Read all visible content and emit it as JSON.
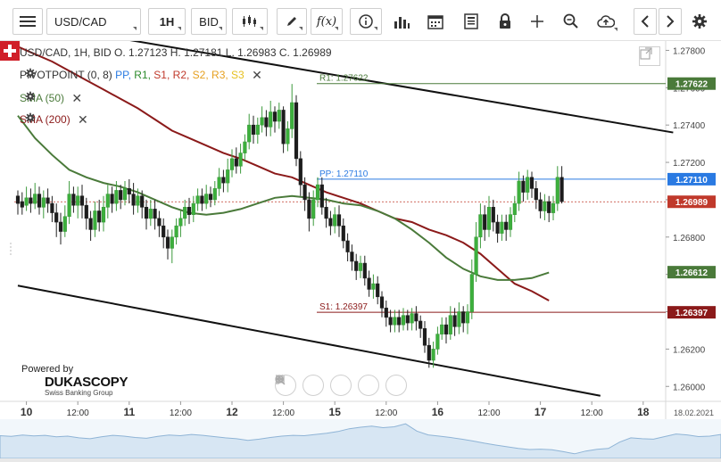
{
  "toolbar": {
    "symbol": "USD/CAD",
    "timeframe": "1H",
    "price_side": "BID",
    "function_label": "f(x)"
  },
  "legend": {
    "ohlc": "USD/CAD, 1H, BID   O. 1.27123 H. 1.27181 L. 1.26983 C. 1.26989",
    "pivot_title": "PIVOTPOINT (0, 8)",
    "pivot_items": [
      {
        "label": "PP,",
        "color": "#2a7ae2"
      },
      {
        "label": "R1,",
        "color": "#2e8b2e"
      },
      {
        "label": "S1,",
        "color": "#c0392b"
      },
      {
        "label": "R2,",
        "color": "#c0392b"
      },
      {
        "label": "S2,",
        "color": "#e6a020"
      },
      {
        "label": "R3,",
        "color": "#e6a020"
      },
      {
        "label": "S3",
        "color": "#e6c020"
      }
    ],
    "sma50": "SMA (50)",
    "sma200": "SMA (200)",
    "sma50_color": "#4a7a3a",
    "sma200_color": "#8b1a1a"
  },
  "branding": {
    "powered": "Powered by",
    "name": "DUKASCOPY",
    "sub": "Swiss Banking Group"
  },
  "chart_data": {
    "type": "candlestick",
    "ylim": [
      1.2592,
      1.2785
    ],
    "y_ticks": [
      "1.27800",
      "1.27600",
      "1.27400",
      "1.27200",
      "1.27000",
      "1.26800",
      "1.26600",
      "1.26400",
      "1.26200",
      "1.26000"
    ],
    "y_tick_values": [
      1.278,
      1.276,
      1.274,
      1.272,
      1.27,
      1.268,
      1.266,
      1.264,
      1.262,
      1.26
    ],
    "x_ticks": [
      {
        "label": "10",
        "bold": true,
        "i": 2
      },
      {
        "label": "12:00",
        "bold": false,
        "i": 14
      },
      {
        "label": "11",
        "bold": true,
        "i": 26
      },
      {
        "label": "12:00",
        "bold": false,
        "i": 38
      },
      {
        "label": "12",
        "bold": true,
        "i": 50
      },
      {
        "label": "12:00",
        "bold": false,
        "i": 62
      },
      {
        "label": "15",
        "bold": true,
        "i": 74
      },
      {
        "label": "12:00",
        "bold": false,
        "i": 86
      },
      {
        "label": "16",
        "bold": true,
        "i": 98
      },
      {
        "label": "12:00",
        "bold": false,
        "i": 110
      },
      {
        "label": "17",
        "bold": true,
        "i": 122
      },
      {
        "label": "12:00",
        "bold": false,
        "i": 134
      },
      {
        "label": "18",
        "bold": true,
        "i": 146
      }
    ],
    "date_right": "18.02.2021",
    "pivot_levels": [
      {
        "name": "R1",
        "label": "R1: 1.27622",
        "value": 1.27622,
        "badge": "1.27622",
        "color": "#4a7a3a"
      },
      {
        "name": "PP",
        "label": "PP: 1.27110",
        "value": 1.2711,
        "badge": "1.27110",
        "color": "#2a7ae2"
      },
      {
        "name": "S1",
        "label": "S1: 1.26397",
        "value": 1.26397,
        "badge": "1.26397",
        "color": "#8b1a1a"
      }
    ],
    "last_price": {
      "value": 1.26989,
      "badge": "1.26989",
      "color": "#c0392b"
    },
    "sma50_last": {
      "value": 1.26612,
      "badge": "1.26612",
      "color": "#4a7a3a"
    },
    "channel_lines": [
      {
        "i1": 12,
        "v1": 1.2791,
        "i2": 153,
        "v2": 1.2736
      },
      {
        "i1": 0,
        "v1": 1.2654,
        "i2": 136,
        "v2": 1.2595
      }
    ],
    "sma200": {
      "start_i": 0,
      "step": 4,
      "values": [
        1.2782,
        1.2778,
        1.2774,
        1.2769,
        1.2764,
        1.2759,
        1.2754,
        1.2749,
        1.2743,
        1.2737,
        1.2733,
        1.2729,
        1.2725,
        1.2722,
        1.2718,
        1.2714,
        1.2712,
        1.2708,
        1.2704,
        1.2701,
        1.2698,
        1.2694,
        1.269,
        1.2688,
        1.2684,
        1.2681,
        1.2677,
        1.2671,
        1.2663,
        1.2655,
        1.2651,
        1.2646
      ]
    },
    "sma50": {
      "start_i": 0,
      "step": 4,
      "values": [
        1.2745,
        1.2733,
        1.2724,
        1.2716,
        1.2712,
        1.2709,
        1.2707,
        1.2704,
        1.27,
        1.2696,
        1.2693,
        1.2692,
        1.2693,
        1.2695,
        1.2698,
        1.2701,
        1.2702,
        1.2701,
        1.27,
        1.2698,
        1.2697,
        1.2694,
        1.269,
        1.2684,
        1.2677,
        1.2669,
        1.2663,
        1.2659,
        1.2657,
        1.2657,
        1.2658,
        1.2661
      ]
    },
    "candles": [
      [
        1.2702,
        1.2698,
        1.2705,
        1.2692
      ],
      [
        1.2699,
        1.2696,
        1.2704,
        1.2692
      ],
      [
        1.2697,
        1.2701,
        1.2707,
        1.2694
      ],
      [
        1.2701,
        1.2698,
        1.2706,
        1.2693
      ],
      [
        1.2698,
        1.2703,
        1.2709,
        1.2695
      ],
      [
        1.2703,
        1.2696,
        1.2707,
        1.2692
      ],
      [
        1.2696,
        1.2701,
        1.2705,
        1.269
      ],
      [
        1.2701,
        1.2698,
        1.2706,
        1.2693
      ],
      [
        1.2698,
        1.2693,
        1.2702,
        1.2688
      ],
      [
        1.2693,
        1.2688,
        1.2698,
        1.268
      ],
      [
        1.2688,
        1.2683,
        1.2693,
        1.2676
      ],
      [
        1.2683,
        1.2691,
        1.2697,
        1.268
      ],
      [
        1.2691,
        1.2703,
        1.271,
        1.2687
      ],
      [
        1.2703,
        1.2697,
        1.2707,
        1.2693
      ],
      [
        1.2697,
        1.2702,
        1.2707,
        1.269
      ],
      [
        1.2702,
        1.2697,
        1.2708,
        1.269
      ],
      [
        1.2697,
        1.269,
        1.2701,
        1.2684
      ],
      [
        1.269,
        1.2684,
        1.2694,
        1.2678
      ],
      [
        1.2684,
        1.2694,
        1.2699,
        1.268
      ],
      [
        1.2694,
        1.2688,
        1.27,
        1.2683
      ],
      [
        1.2688,
        1.2696,
        1.2702,
        1.2683
      ],
      [
        1.2696,
        1.2703,
        1.2708,
        1.269
      ],
      [
        1.2703,
        1.2698,
        1.2707,
        1.2693
      ],
      [
        1.2698,
        1.2705,
        1.271,
        1.2694
      ],
      [
        1.2705,
        1.27,
        1.2708,
        1.2695
      ],
      [
        1.27,
        1.2706,
        1.271,
        1.2697
      ],
      [
        1.2706,
        1.2703,
        1.2711,
        1.2698
      ],
      [
        1.2703,
        1.2697,
        1.2709,
        1.2692
      ],
      [
        1.2697,
        1.2702,
        1.2706,
        1.2693
      ],
      [
        1.2702,
        1.2696,
        1.2705,
        1.269
      ],
      [
        1.2696,
        1.269,
        1.27,
        1.2684
      ],
      [
        1.269,
        1.2695,
        1.27,
        1.2686
      ],
      [
        1.2695,
        1.269,
        1.27,
        1.2684
      ],
      [
        1.269,
        1.2686,
        1.2694,
        1.268
      ],
      [
        1.2686,
        1.268,
        1.269,
        1.2674
      ],
      [
        1.268,
        1.2674,
        1.2684,
        1.2668
      ],
      [
        1.2674,
        1.268,
        1.2684,
        1.2666
      ],
      [
        1.268,
        1.2686,
        1.269,
        1.2676
      ],
      [
        1.2686,
        1.269,
        1.2694,
        1.268
      ],
      [
        1.269,
        1.2696,
        1.27,
        1.2686
      ],
      [
        1.2696,
        1.2692,
        1.2701,
        1.2687
      ],
      [
        1.2692,
        1.2698,
        1.2702,
        1.2688
      ],
      [
        1.2698,
        1.2702,
        1.2706,
        1.2694
      ],
      [
        1.2702,
        1.2698,
        1.2706,
        1.2694
      ],
      [
        1.2698,
        1.2703,
        1.2708,
        1.2695
      ],
      [
        1.2703,
        1.27,
        1.2707,
        1.2696
      ],
      [
        1.27,
        1.2706,
        1.271,
        1.2697
      ],
      [
        1.2706,
        1.2712,
        1.2717,
        1.2702
      ],
      [
        1.2712,
        1.2709,
        1.2716,
        1.2704
      ],
      [
        1.2709,
        1.2716,
        1.2722,
        1.2704
      ],
      [
        1.2716,
        1.2722,
        1.2727,
        1.2712
      ],
      [
        1.2722,
        1.2718,
        1.2728,
        1.2714
      ],
      [
        1.2718,
        1.2725,
        1.273,
        1.2714
      ],
      [
        1.2725,
        1.2731,
        1.2735,
        1.2721
      ],
      [
        1.2731,
        1.274,
        1.2746,
        1.2727
      ],
      [
        1.274,
        1.2735,
        1.2745,
        1.273
      ],
      [
        1.2735,
        1.274,
        1.2744,
        1.273
      ],
      [
        1.274,
        1.2744,
        1.275,
        1.2736
      ],
      [
        1.2744,
        1.2739,
        1.2748,
        1.2734
      ],
      [
        1.2739,
        1.2747,
        1.2753,
        1.2734
      ],
      [
        1.2747,
        1.2742,
        1.275,
        1.2736
      ],
      [
        1.2742,
        1.2748,
        1.2752,
        1.2738
      ],
      [
        1.2748,
        1.273,
        1.275,
        1.2725
      ],
      [
        1.273,
        1.2738,
        1.2742,
        1.2726
      ],
      [
        1.2738,
        1.2752,
        1.2762,
        1.2733
      ],
      [
        1.2752,
        1.2722,
        1.2756,
        1.2718
      ],
      [
        1.2722,
        1.2708,
        1.2726,
        1.2702
      ],
      [
        1.2708,
        1.27,
        1.2712,
        1.2694
      ],
      [
        1.27,
        1.269,
        1.2704,
        1.2683
      ],
      [
        1.269,
        1.27,
        1.2705,
        1.2686
      ],
      [
        1.27,
        1.2708,
        1.2712,
        1.2696
      ],
      [
        1.2708,
        1.2696,
        1.2712,
        1.2692
      ],
      [
        1.2696,
        1.269,
        1.2701,
        1.2685
      ],
      [
        1.269,
        1.2686,
        1.2694,
        1.2681
      ],
      [
        1.2686,
        1.2692,
        1.2696,
        1.2682
      ],
      [
        1.2692,
        1.2686,
        1.2697,
        1.268
      ],
      [
        1.2686,
        1.2678,
        1.269,
        1.2674
      ],
      [
        1.2678,
        1.2672,
        1.2682,
        1.2667
      ],
      [
        1.2672,
        1.2667,
        1.2676,
        1.2662
      ],
      [
        1.2667,
        1.2662,
        1.2671,
        1.2657
      ],
      [
        1.2662,
        1.2666,
        1.267,
        1.2658
      ],
      [
        1.2666,
        1.2658,
        1.267,
        1.2654
      ],
      [
        1.2658,
        1.2652,
        1.2662,
        1.2648
      ],
      [
        1.2652,
        1.2655,
        1.266,
        1.2647
      ],
      [
        1.2655,
        1.2648,
        1.2659,
        1.2644
      ],
      [
        1.2648,
        1.2642,
        1.2651,
        1.2637
      ],
      [
        1.2642,
        1.2637,
        1.2646,
        1.2632
      ],
      [
        1.2637,
        1.2633,
        1.2641,
        1.2629
      ],
      [
        1.2633,
        1.2637,
        1.2641,
        1.2629
      ],
      [
        1.2637,
        1.2633,
        1.2641,
        1.2629
      ],
      [
        1.2633,
        1.2638,
        1.2642,
        1.263
      ],
      [
        1.2638,
        1.2634,
        1.2641,
        1.263
      ],
      [
        1.2634,
        1.2639,
        1.2642,
        1.263
      ],
      [
        1.2639,
        1.2635,
        1.2643,
        1.263
      ],
      [
        1.2635,
        1.2631,
        1.2638,
        1.2626
      ],
      [
        1.2631,
        1.2622,
        1.2635,
        1.2618
      ],
      [
        1.2622,
        1.2614,
        1.2626,
        1.261
      ],
      [
        1.2614,
        1.262,
        1.2624,
        1.261
      ],
      [
        1.262,
        1.2628,
        1.2632,
        1.2617
      ],
      [
        1.2628,
        1.2633,
        1.2637,
        1.2625
      ],
      [
        1.2633,
        1.2628,
        1.2637,
        1.2623
      ],
      [
        1.2628,
        1.2638,
        1.2643,
        1.2625
      ],
      [
        1.2638,
        1.2632,
        1.2642,
        1.2627
      ],
      [
        1.2632,
        1.264,
        1.2645,
        1.2628
      ],
      [
        1.264,
        1.2634,
        1.2643,
        1.2629
      ],
      [
        1.2634,
        1.264,
        1.2644,
        1.2628
      ],
      [
        1.264,
        1.266,
        1.2668,
        1.2636
      ],
      [
        1.266,
        1.268,
        1.2688,
        1.2656
      ],
      [
        1.268,
        1.2692,
        1.2698,
        1.2674
      ],
      [
        1.2692,
        1.2684,
        1.2697,
        1.2678
      ],
      [
        1.2684,
        1.2696,
        1.2702,
        1.268
      ],
      [
        1.2696,
        1.2688,
        1.27,
        1.2683
      ],
      [
        1.2688,
        1.2682,
        1.2692,
        1.2677
      ],
      [
        1.2682,
        1.2688,
        1.2692,
        1.2678
      ],
      [
        1.2688,
        1.2684,
        1.2692,
        1.2678
      ],
      [
        1.2684,
        1.2692,
        1.2696,
        1.268
      ],
      [
        1.2692,
        1.2698,
        1.2702,
        1.2688
      ],
      [
        1.2698,
        1.271,
        1.2715,
        1.2694
      ],
      [
        1.271,
        1.2704,
        1.2713,
        1.2699
      ],
      [
        1.2704,
        1.2712,
        1.2716,
        1.27
      ],
      [
        1.2712,
        1.2706,
        1.2715,
        1.2701
      ],
      [
        1.2706,
        1.27,
        1.271,
        1.2695
      ],
      [
        1.27,
        1.2694,
        1.2704,
        1.269
      ],
      [
        1.2694,
        1.2699,
        1.2703,
        1.2689
      ],
      [
        1.2699,
        1.2693,
        1.2702,
        1.2688
      ],
      [
        1.2693,
        1.2698,
        1.2702,
        1.2689
      ],
      [
        1.2698,
        1.2712,
        1.2718,
        1.2694
      ],
      [
        1.2712,
        1.2699,
        1.2718,
        1.2698
      ]
    ]
  },
  "navigator": {
    "values": [
      1.27,
      1.2697,
      1.2703,
      1.2699,
      1.2702,
      1.2695,
      1.2698,
      1.269,
      1.2686,
      1.2695,
      1.2702,
      1.2698,
      1.2692,
      1.2688,
      1.2697,
      1.2703,
      1.27,
      1.2706,
      1.2702,
      1.2696,
      1.269,
      1.2686,
      1.2678,
      1.2684,
      1.2692,
      1.2698,
      1.2702,
      1.27,
      1.2706,
      1.2712,
      1.272,
      1.2733,
      1.274,
      1.2745,
      1.2738,
      1.2742,
      1.2756,
      1.2722,
      1.2704,
      1.2698,
      1.2692,
      1.2684,
      1.2675,
      1.2665,
      1.2656,
      1.2648,
      1.264,
      1.2635,
      1.2637,
      1.2634,
      1.2625,
      1.2615,
      1.2628,
      1.2636,
      1.264,
      1.267,
      1.269,
      1.2686,
      1.2684,
      1.2696,
      1.2708,
      1.2704,
      1.2696,
      1.2698,
      1.2706
    ]
  }
}
